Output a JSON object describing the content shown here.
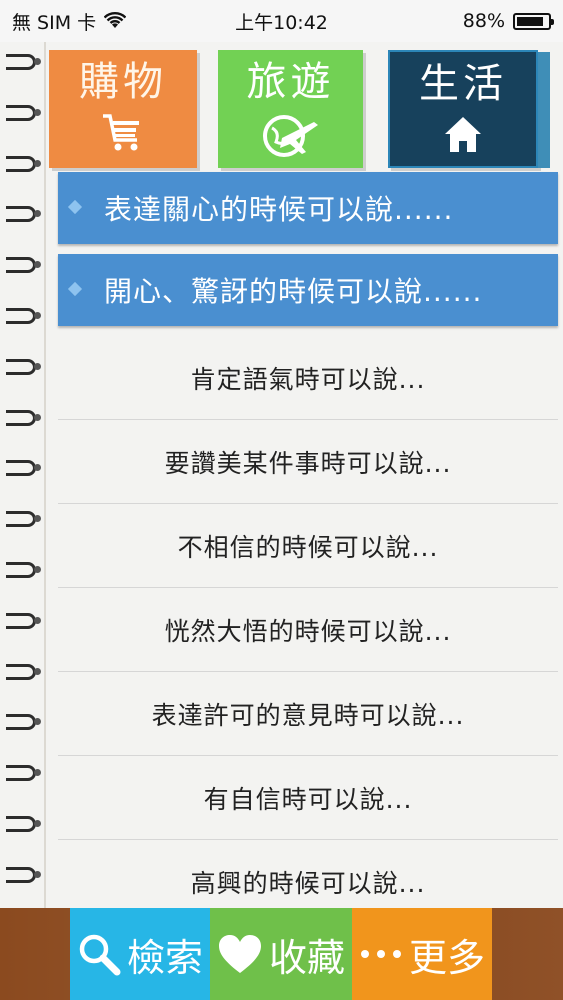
{
  "status_bar": {
    "carrier": "無 SIM 卡",
    "time": "上午10:42",
    "battery": "88%",
    "battery_level": 0.88
  },
  "tabs": [
    {
      "label": "購物",
      "icon": "shopping-cart-icon"
    },
    {
      "label": "旅遊",
      "icon": "airplane-globe-icon"
    },
    {
      "label": "生活",
      "icon": "home-icon"
    }
  ],
  "banners": [
    {
      "text": "表達關心的時候可以說......"
    },
    {
      "text": "開心、驚訝的時候可以說......"
    }
  ],
  "items": [
    {
      "text": "肯定語氣時可以說..."
    },
    {
      "text": "要讚美某件事時可以說..."
    },
    {
      "text": "不相信的時候可以說..."
    },
    {
      "text": "恍然大悟的時候可以說..."
    },
    {
      "text": "表達許可的意見時可以說..."
    },
    {
      "text": "有自信時可以說..."
    },
    {
      "text": "高興的時候可以說..."
    }
  ],
  "bottom_bar": {
    "search": {
      "label": "檢索",
      "icon": "search-icon"
    },
    "favorites": {
      "label": "收藏",
      "icon": "heart-icon"
    },
    "more": {
      "label": "更多",
      "icon": "ellipsis-icon"
    }
  },
  "colors": {
    "shop_tab": "#ef8b42",
    "travel_tab": "#72d154",
    "life_tab": "#17415c",
    "banner": "#4a8fd0",
    "search_button": "#27b6e6",
    "favorites_button": "#6fc04a",
    "more_button": "#f1951c",
    "bottom_bar": "#8b4a1f"
  }
}
